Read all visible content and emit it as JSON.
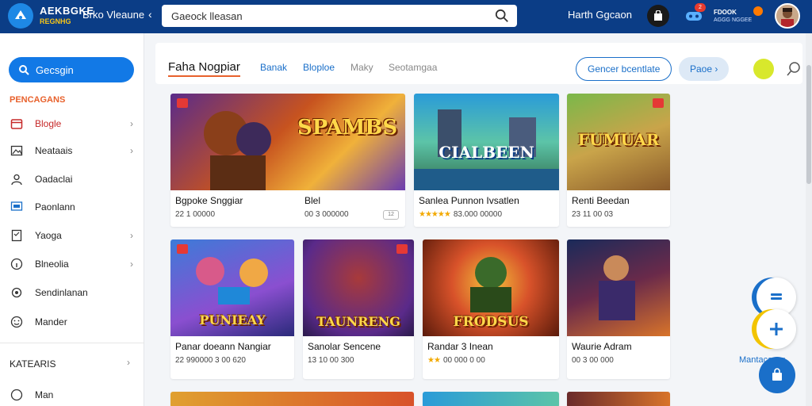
{
  "header": {
    "brand": "AEKBGKE",
    "brand_sub": "REGNHG",
    "nav_link": "Brko Vleaune",
    "search_value": "Gaeock lleasan",
    "user_name": "Harth Ggcaon",
    "notif_count": "2",
    "acct_label": "FDOOK",
    "acct_sub": "AGGG NGGEE"
  },
  "sidebar": {
    "primary_button": "Gecsgin",
    "section_title": "PENCAGANS",
    "items": [
      {
        "label": "Blogle",
        "has_chevron": true,
        "active": true
      },
      {
        "label": "Neataais",
        "has_chevron": true,
        "active": false
      },
      {
        "label": "Oadaclai",
        "has_chevron": false,
        "active": false
      },
      {
        "label": "Paonlann",
        "has_chevron": false,
        "active": false
      },
      {
        "label": "Yaoga",
        "has_chevron": true,
        "active": false
      },
      {
        "label": "Blneolia",
        "has_chevron": true,
        "active": false
      },
      {
        "label": "Sendinlanan",
        "has_chevron": false,
        "active": false
      },
      {
        "label": "Mander",
        "has_chevron": false,
        "active": false
      }
    ],
    "category_title": "KATEARIS",
    "last_item": "Man"
  },
  "filterbar": {
    "main_tab": "Faha Nogpiar",
    "tabs": [
      "Banak",
      "Bloploe",
      "Maky",
      "Seotamgaa"
    ],
    "outline_button": "Gencer bcentlate",
    "fill_button": "Paoe"
  },
  "cards": [
    {
      "art_title": "SPAMBS",
      "name": "Bgpoke Snggiar",
      "stars": "",
      "meta": "22 1 00000",
      "tag": "12"
    },
    {
      "art_title": "",
      "name": "Blel",
      "stars": "",
      "meta": "00 3 000000",
      "tag": ""
    },
    {
      "art_title": "CIALBEEN",
      "name": "Sanlea Punnon Ivsatlen",
      "stars": "★★★★★",
      "meta": "83.000 00000",
      "tag": ""
    },
    {
      "art_title": "FUMUAR",
      "name": "Renti Beedan",
      "stars": "",
      "meta": "23 11 00 03",
      "tag": ""
    },
    {
      "art_title": "PUNIEAY",
      "name": "Panar doeann Nangiar",
      "stars": "",
      "meta": "22 990000 3 00 620",
      "tag": ""
    },
    {
      "art_title": "TAUNRENG",
      "name": "Sanolar Sencene",
      "stars": "",
      "meta": "13 10 00 300",
      "tag": ""
    },
    {
      "art_title": "FRODSUS",
      "name": "Randar 3 Inean",
      "stars": "★★",
      "meta": "00 000 0 00",
      "tag": ""
    },
    {
      "art_title": "",
      "name": "Waurie Adram",
      "stars": "",
      "meta": "00 3 00 000",
      "tag": ""
    }
  ],
  "fab_label": "Mantacauer",
  "colors": {
    "header_bg": "#0b3d86",
    "accent_blue": "#1279e6",
    "accent_orange": "#e8612c",
    "active_red": "#c62828"
  }
}
